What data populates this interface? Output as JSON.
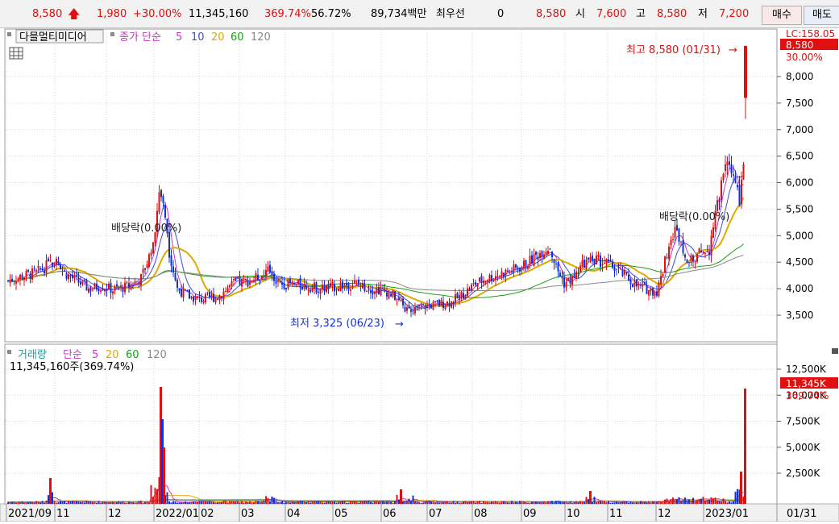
{
  "quote": {
    "price": "8,580",
    "change": "1,980",
    "change_rate": "+30.00%",
    "volume": "11,345,160",
    "volume_ratio": "369.74%",
    "turnover": "56.72%",
    "trade_amount": "89,734백만",
    "best_bid_label": "최우선",
    "best_bid_value": "0",
    "best_price": "8,580",
    "open_label": "시",
    "open": "7,600",
    "high_label": "고",
    "high": "8,580",
    "low_label": "저",
    "low": "7,200",
    "buy_button": "매수",
    "sell_button": "매도"
  },
  "price_panel": {
    "stock_name": "다믈멀티미디어",
    "ma_title": "종가 단순",
    "ma_periods": [
      "5",
      "10",
      "20",
      "60",
      "120"
    ],
    "ma_colors": [
      "#cc33cc",
      "#3a4fd6",
      "#e0a800",
      "#18a018",
      "#888888"
    ],
    "y_labels": [
      "8,000",
      "7,500",
      "7,000",
      "6,500",
      "6,000",
      "5,500",
      "5,000",
      "4,500",
      "4,000",
      "3,500"
    ],
    "top_label": "LC:158.05",
    "last_price_tag": "8,580",
    "last_rate_tag": "30.00%",
    "high_annotation": "최고 8,580 (01/31)",
    "low_annotation": "최저 3,325 (06/23)",
    "dividend_label_1": "배당락(0.00%)",
    "dividend_label_2": "배당락(0.00%)"
  },
  "volume_panel": {
    "title": "거래량",
    "ma_title": "단순",
    "ma_periods": [
      "5",
      "20",
      "60",
      "120"
    ],
    "ma_colors": [
      "#cc33cc",
      "#e0a800",
      "#18a018",
      "#888888"
    ],
    "current": "11,345,160주(369.74%)",
    "y_labels": [
      "12,500K",
      "10,000K",
      "7,500K",
      "5,000K",
      "2,500K"
    ],
    "last_vol_tag": "11,345K",
    "last_ratio_tag": "369.74%"
  },
  "x_axis": {
    "labels": [
      "2021/09",
      "11",
      "12",
      "2022/01",
      "02",
      "03",
      "04",
      "05",
      "06",
      "07",
      "08",
      "09",
      "10",
      "11",
      "12",
      "2023/01"
    ],
    "right_label": "01/31"
  },
  "colors": {
    "up": "#e01010",
    "down": "#1030e0",
    "grid": "#d9d9d9",
    "tag_bg": "#e01010"
  }
}
